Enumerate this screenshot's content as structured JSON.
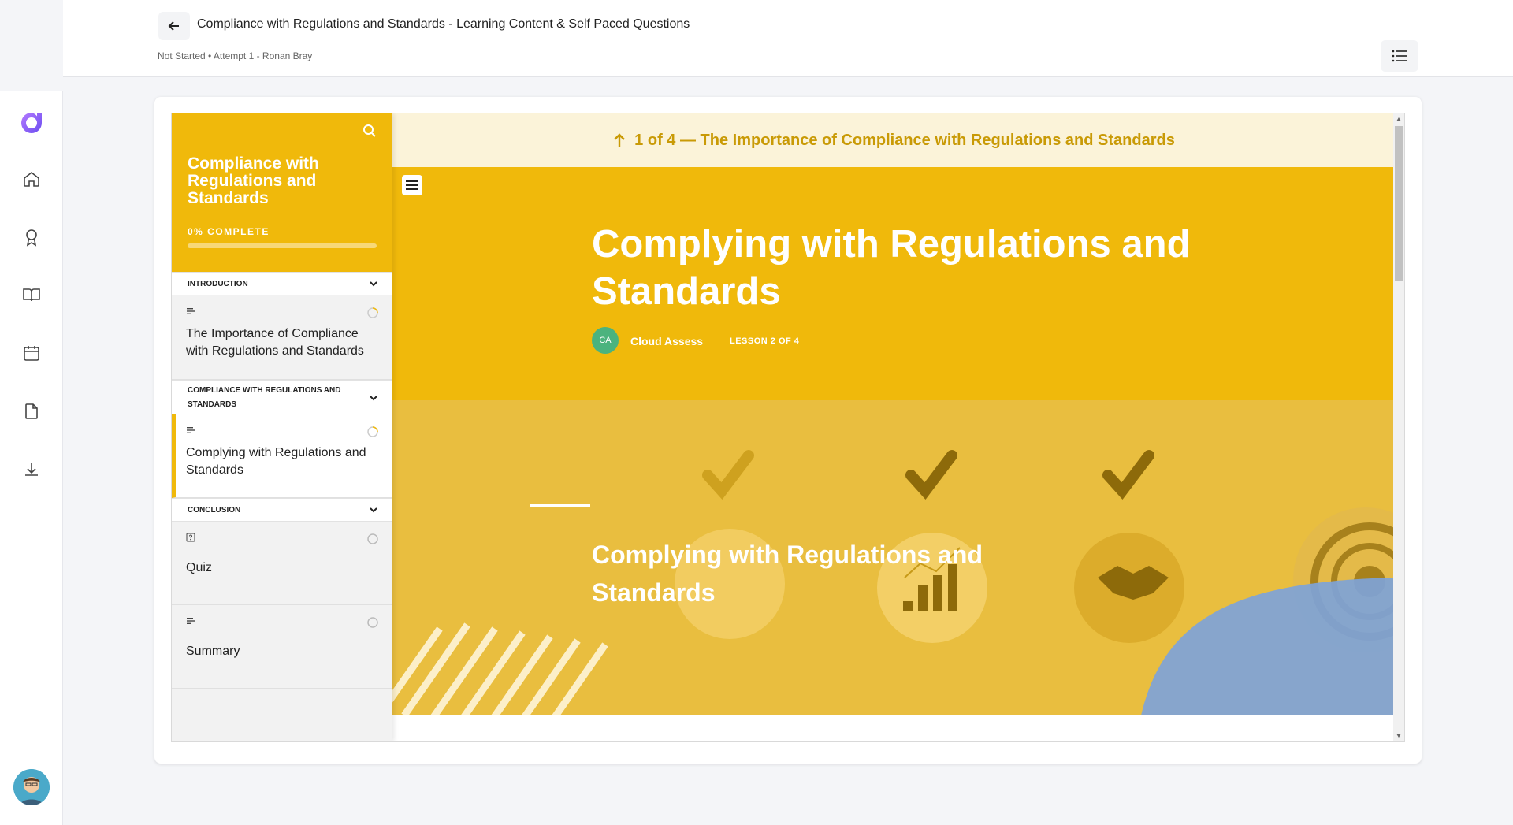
{
  "header": {
    "title": "Compliance with Regulations and Standards - Learning Content & Self Paced Questions",
    "meta": "Not Started • Attempt 1 - Ronan Bray"
  },
  "rail": {
    "icons": [
      "logo-icon",
      "home-icon",
      "award-icon",
      "book-icon",
      "calendar-icon",
      "file-icon",
      "download-icon"
    ]
  },
  "course": {
    "title": "Compliance with Regulations and Standards",
    "progress_label": "0% COMPLETE",
    "progress": 0,
    "sections": [
      {
        "label": "INTRODUCTION",
        "lessons": [
          {
            "label": "The Importance of Compliance with Regulations and Standards",
            "type": "text-icon",
            "status": "in-progress"
          }
        ]
      },
      {
        "label": "COMPLIANCE WITH REGULATIONS AND STANDARDS",
        "lessons": [
          {
            "label": "Complying with Regulations and Standards",
            "type": "text-icon",
            "status": "in-progress"
          }
        ]
      },
      {
        "label": "CONCLUSION",
        "lessons": [
          {
            "label": "Quiz",
            "type": "quiz-icon",
            "status": "not-started"
          },
          {
            "label": "Summary",
            "type": "text-icon",
            "status": "not-started"
          }
        ]
      }
    ]
  },
  "lesson": {
    "prev_nav": "1 of 4 — The Importance of Compliance with Regulations and Standards",
    "title": "Complying with Regulations and Standards",
    "author_initials": "CA",
    "author": "Cloud Assess",
    "lesson_count": "LESSON 2 OF 4",
    "banner_title": "Complying with Regulations and Standards"
  },
  "colors": {
    "accent": "#f0b90b",
    "accent_text": "#c99a06",
    "prev_bar": "#fbf3d9",
    "brand": "#8b5cf6",
    "author_badge": "#4bb37e"
  }
}
